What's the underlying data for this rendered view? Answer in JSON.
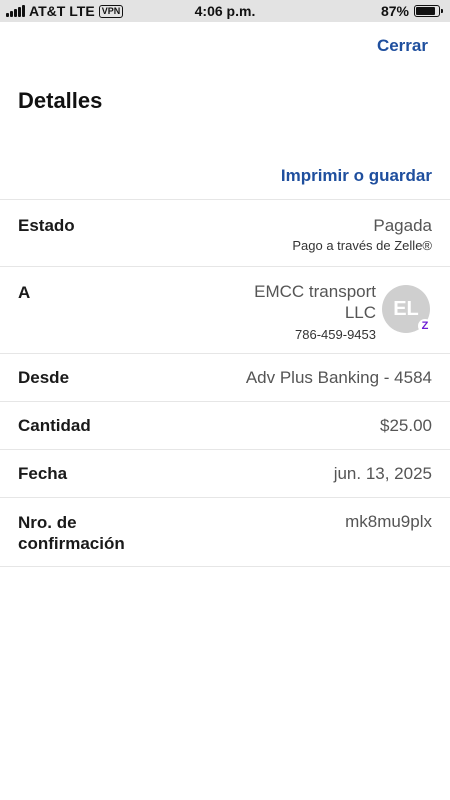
{
  "status_bar": {
    "carrier": "AT&T",
    "network": "LTE",
    "vpn": "VPN",
    "time": "4:06 p.m.",
    "battery_percent": "87%",
    "battery_level": 0.87
  },
  "header": {
    "close_label": "Cerrar",
    "title": "Detalles",
    "print_label": "Imprimir o guardar"
  },
  "details": {
    "estado": {
      "label": "Estado",
      "value": "Pagada",
      "sub": "Pago a través de Zelle®"
    },
    "a": {
      "label": "A",
      "name_line1": "EMCC transport",
      "name_line2": "LLC",
      "phone": "786-459-9453",
      "avatar_initials": "EL",
      "badge": "Z"
    },
    "desde": {
      "label": "Desde",
      "value": "Adv Plus Banking - 4584"
    },
    "cantidad": {
      "label": "Cantidad",
      "value": "$25.00"
    },
    "fecha": {
      "label": "Fecha",
      "value": "jun. 13, 2025"
    },
    "confirmacion": {
      "label_line1": "Nro. de",
      "label_line2": "confirmación",
      "value": "mk8mu9plx"
    }
  },
  "colors": {
    "accent": "#1f4f9e",
    "zelle": "#6d1ed4",
    "status_bar_bg": "#e3e3e3"
  }
}
